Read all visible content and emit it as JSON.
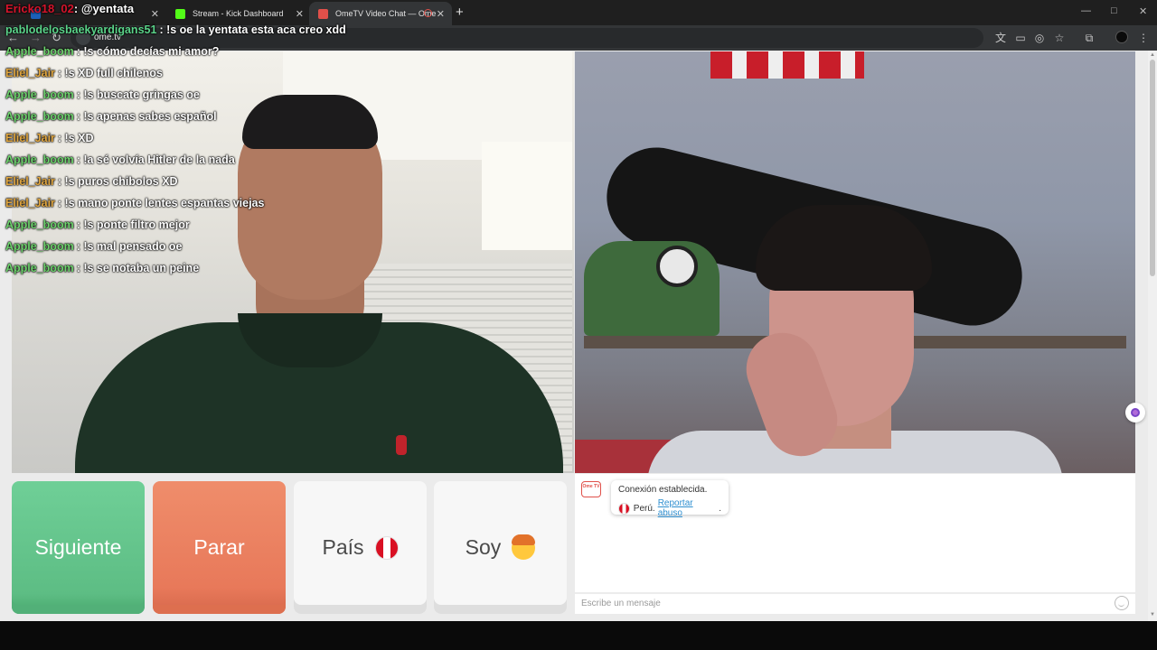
{
  "browser": {
    "tabs": [
      {
        "label": "",
        "close": "✕",
        "favicon_color": "#1b5fb7",
        "active": false
      },
      {
        "label": "Stream - Kick Dashboard",
        "close": "✕",
        "favicon_color": "#53fc18",
        "active": false
      },
      {
        "label": "OmeTV Video Chat — Ome",
        "close": "✕",
        "favicon_color": "#e0504a",
        "active": true
      }
    ],
    "new_tab": "+",
    "url": "ome.tv",
    "window_controls": [
      "—",
      "□",
      "✕"
    ]
  },
  "overlay": {
    "title_user": "Ericko18_02",
    "title_text": ": @yentata",
    "messages": [
      {
        "user": "pablodelosbaekyardigans51",
        "text": ": !s oe la yentata esta aca creo xdd",
        "color": "#5bd48a"
      },
      {
        "user": "Apple_boom",
        "text": ": !s cómo decías mi amor?",
        "color": "#6ed36e"
      },
      {
        "user": "Eliel_Jair",
        "text": ": !s XD full chilenos",
        "color": "#e0a640"
      },
      {
        "user": "Apple_boom",
        "text": ": !s buscate gringas oe",
        "color": "#6ed36e"
      },
      {
        "user": "Apple_boom",
        "text": ": !s apenas sabes español",
        "color": "#6ed36e"
      },
      {
        "user": "Eliel_Jair",
        "text": ": !s XD",
        "color": "#e0a640"
      },
      {
        "user": "Apple_boom",
        "text": ": !a sé volvía Hitler de la nada",
        "color": "#6ed36e"
      },
      {
        "user": "Eliel_Jair",
        "text": ": !s puros chibolos XD",
        "color": "#e0a640"
      },
      {
        "user": "Eliel_Jair",
        "text": ": !s mano ponte lentes espantas viejas",
        "color": "#e0a640"
      },
      {
        "user": "Apple_boom",
        "text": ": !s ponte filtro mejor",
        "color": "#6ed36e"
      },
      {
        "user": "Apple_boom",
        "text": ": !s mal pensado oe",
        "color": "#6ed36e"
      },
      {
        "user": "Apple_boom",
        "text": ": !s se notaba un peine",
        "color": "#6ed36e"
      }
    ]
  },
  "controls": {
    "next": "Siguiente",
    "stop": "Parar",
    "country": "País",
    "gender": "Soy"
  },
  "chat": {
    "logo_text": "Ome TV",
    "status": "Conexión establecida.",
    "country": "Perú.",
    "report": "Reportar abuso",
    "report_suffix": ".",
    "input_placeholder": "Escribe un mensaje"
  }
}
